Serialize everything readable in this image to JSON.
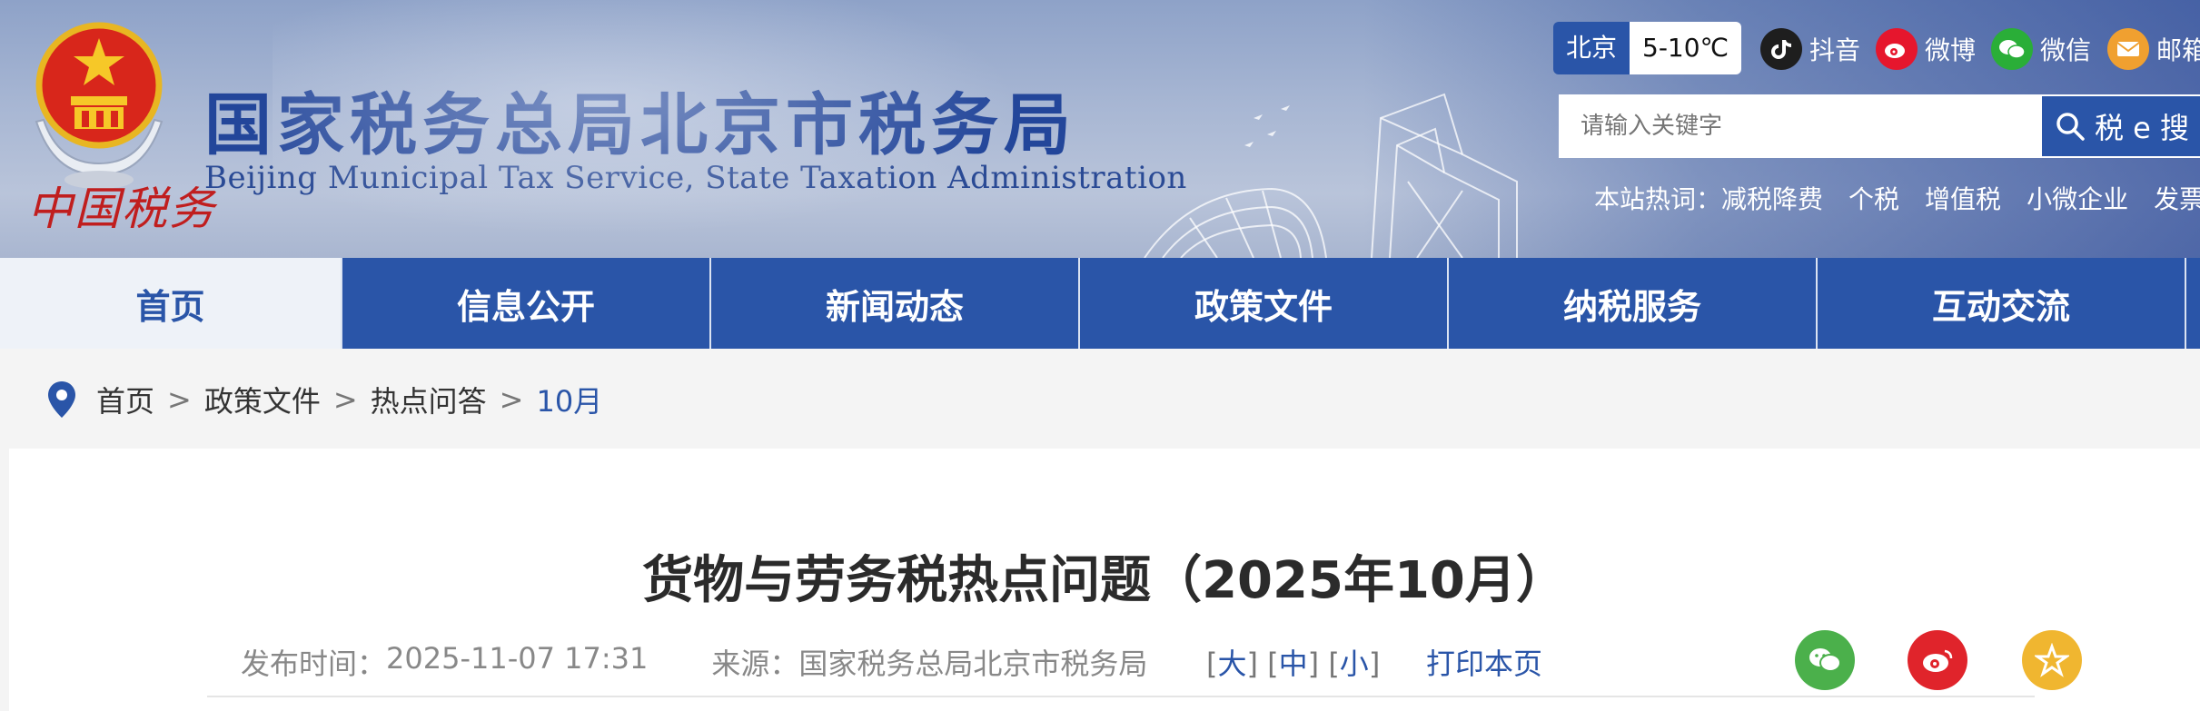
{
  "header": {
    "title": "国家税务总局北京市税务局",
    "subtitle": "Beijing Municipal Tax Service, State Taxation Administration",
    "seal_text": "中国税务",
    "weather": {
      "city": "北京",
      "temp": "5-10℃"
    },
    "social": [
      {
        "label": "抖音",
        "icon": "tiktok-icon",
        "color": "#1e1e1e"
      },
      {
        "label": "微博",
        "icon": "weibo-icon",
        "color": "#e6162d"
      },
      {
        "label": "微信",
        "icon": "wechat-icon",
        "color": "#2aae38"
      },
      {
        "label": "邮箱",
        "icon": "mail-icon",
        "color": "#f0a030"
      }
    ],
    "search": {
      "placeholder": "请输入关键字",
      "button_label": "税 e 搜"
    },
    "hotwords": {
      "label": "本站热词：",
      "items": [
        "减税降费",
        "个税",
        "增值税",
        "小微企业",
        "发票"
      ]
    }
  },
  "nav": [
    "首页",
    "信息公开",
    "新闻动态",
    "政策文件",
    "纳税服务",
    "互动交流"
  ],
  "breadcrumb": [
    "首页",
    "政策文件",
    "热点问答",
    "10月"
  ],
  "article": {
    "title": "货物与劳务税热点问题（2025年10月）",
    "publish_label": "发布时间：",
    "publish_time": "2025-11-07 17:31",
    "source_label": "来源：",
    "source": "国家税务总局北京市税务局",
    "font_sizes": [
      "大",
      "中",
      "小"
    ],
    "print_label": "打印本页"
  },
  "colors": {
    "brand_blue": "#2a55a8",
    "title_blue": "#23469a",
    "share_wechat": "#4bb04b",
    "share_weibo": "#e0242b",
    "share_fav": "#f0b630"
  }
}
